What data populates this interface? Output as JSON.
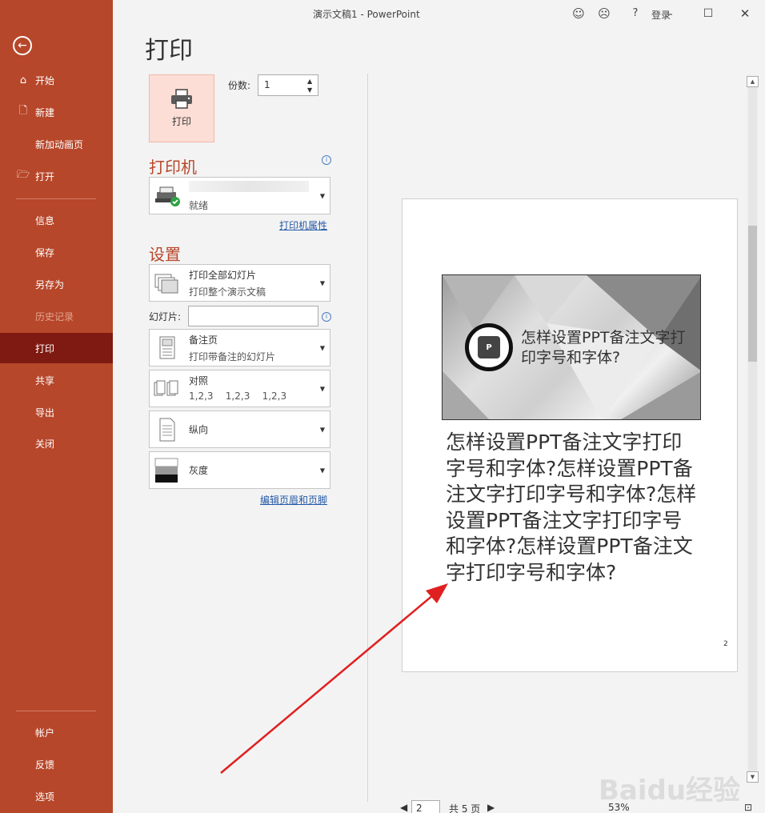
{
  "window": {
    "title": "演示文稿1 - PowerPoint",
    "login": "登录",
    "help": "?"
  },
  "sidebar": {
    "items": [
      {
        "label": "开始",
        "icon": "home-icon"
      },
      {
        "label": "新建",
        "icon": "new-doc-icon"
      },
      {
        "label": "新加动画页",
        "icon": ""
      },
      {
        "label": "打开",
        "icon": "open-folder-icon"
      },
      {
        "label": "信息"
      },
      {
        "label": "保存"
      },
      {
        "label": "另存为"
      },
      {
        "label": "历史记录"
      },
      {
        "label": "打印"
      },
      {
        "label": "共享"
      },
      {
        "label": "导出"
      },
      {
        "label": "关闭"
      },
      {
        "label": "帐户"
      },
      {
        "label": "反馈"
      },
      {
        "label": "选项"
      }
    ]
  },
  "print": {
    "title": "打印",
    "button_label": "打印",
    "copies_label": "份数:",
    "copies_value": "1",
    "printer_title": "打印机",
    "printer_status": "就绪",
    "printer_properties": "打印机属性",
    "settings_title": "设置",
    "range_main": "打印全部幻灯片",
    "range_sub": "打印整个演示文稿",
    "slides_label": "幻灯片:",
    "slides_value": "",
    "layout_main": "备注页",
    "layout_sub": "打印带备注的幻灯片",
    "collate_main": "对照",
    "collate_sub": "1,2,3    1,2,3    1,2,3",
    "orientation_main": "纵向",
    "color_main": "灰度",
    "edit_header_footer": "编辑页眉和页脚"
  },
  "preview": {
    "slide_title": "怎样设置PPT备注文字打印字号和字体?",
    "notes": "怎样设置PPT备注文字打印字号和字体?怎样设置PPT备注文字打印字号和字体?怎样设置PPT备注文字打印字号和字体?怎样设置PPT备注文字打印字号和字体?",
    "page_number": "2",
    "current_page": "2",
    "total_pages": "共 5 页",
    "zoom": "53%"
  },
  "watermark": "Baidu经验",
  "colors": {
    "accent": "#b7472a",
    "sidebar_active": "#7e1a11",
    "annotation_arrow": "#e02020"
  }
}
